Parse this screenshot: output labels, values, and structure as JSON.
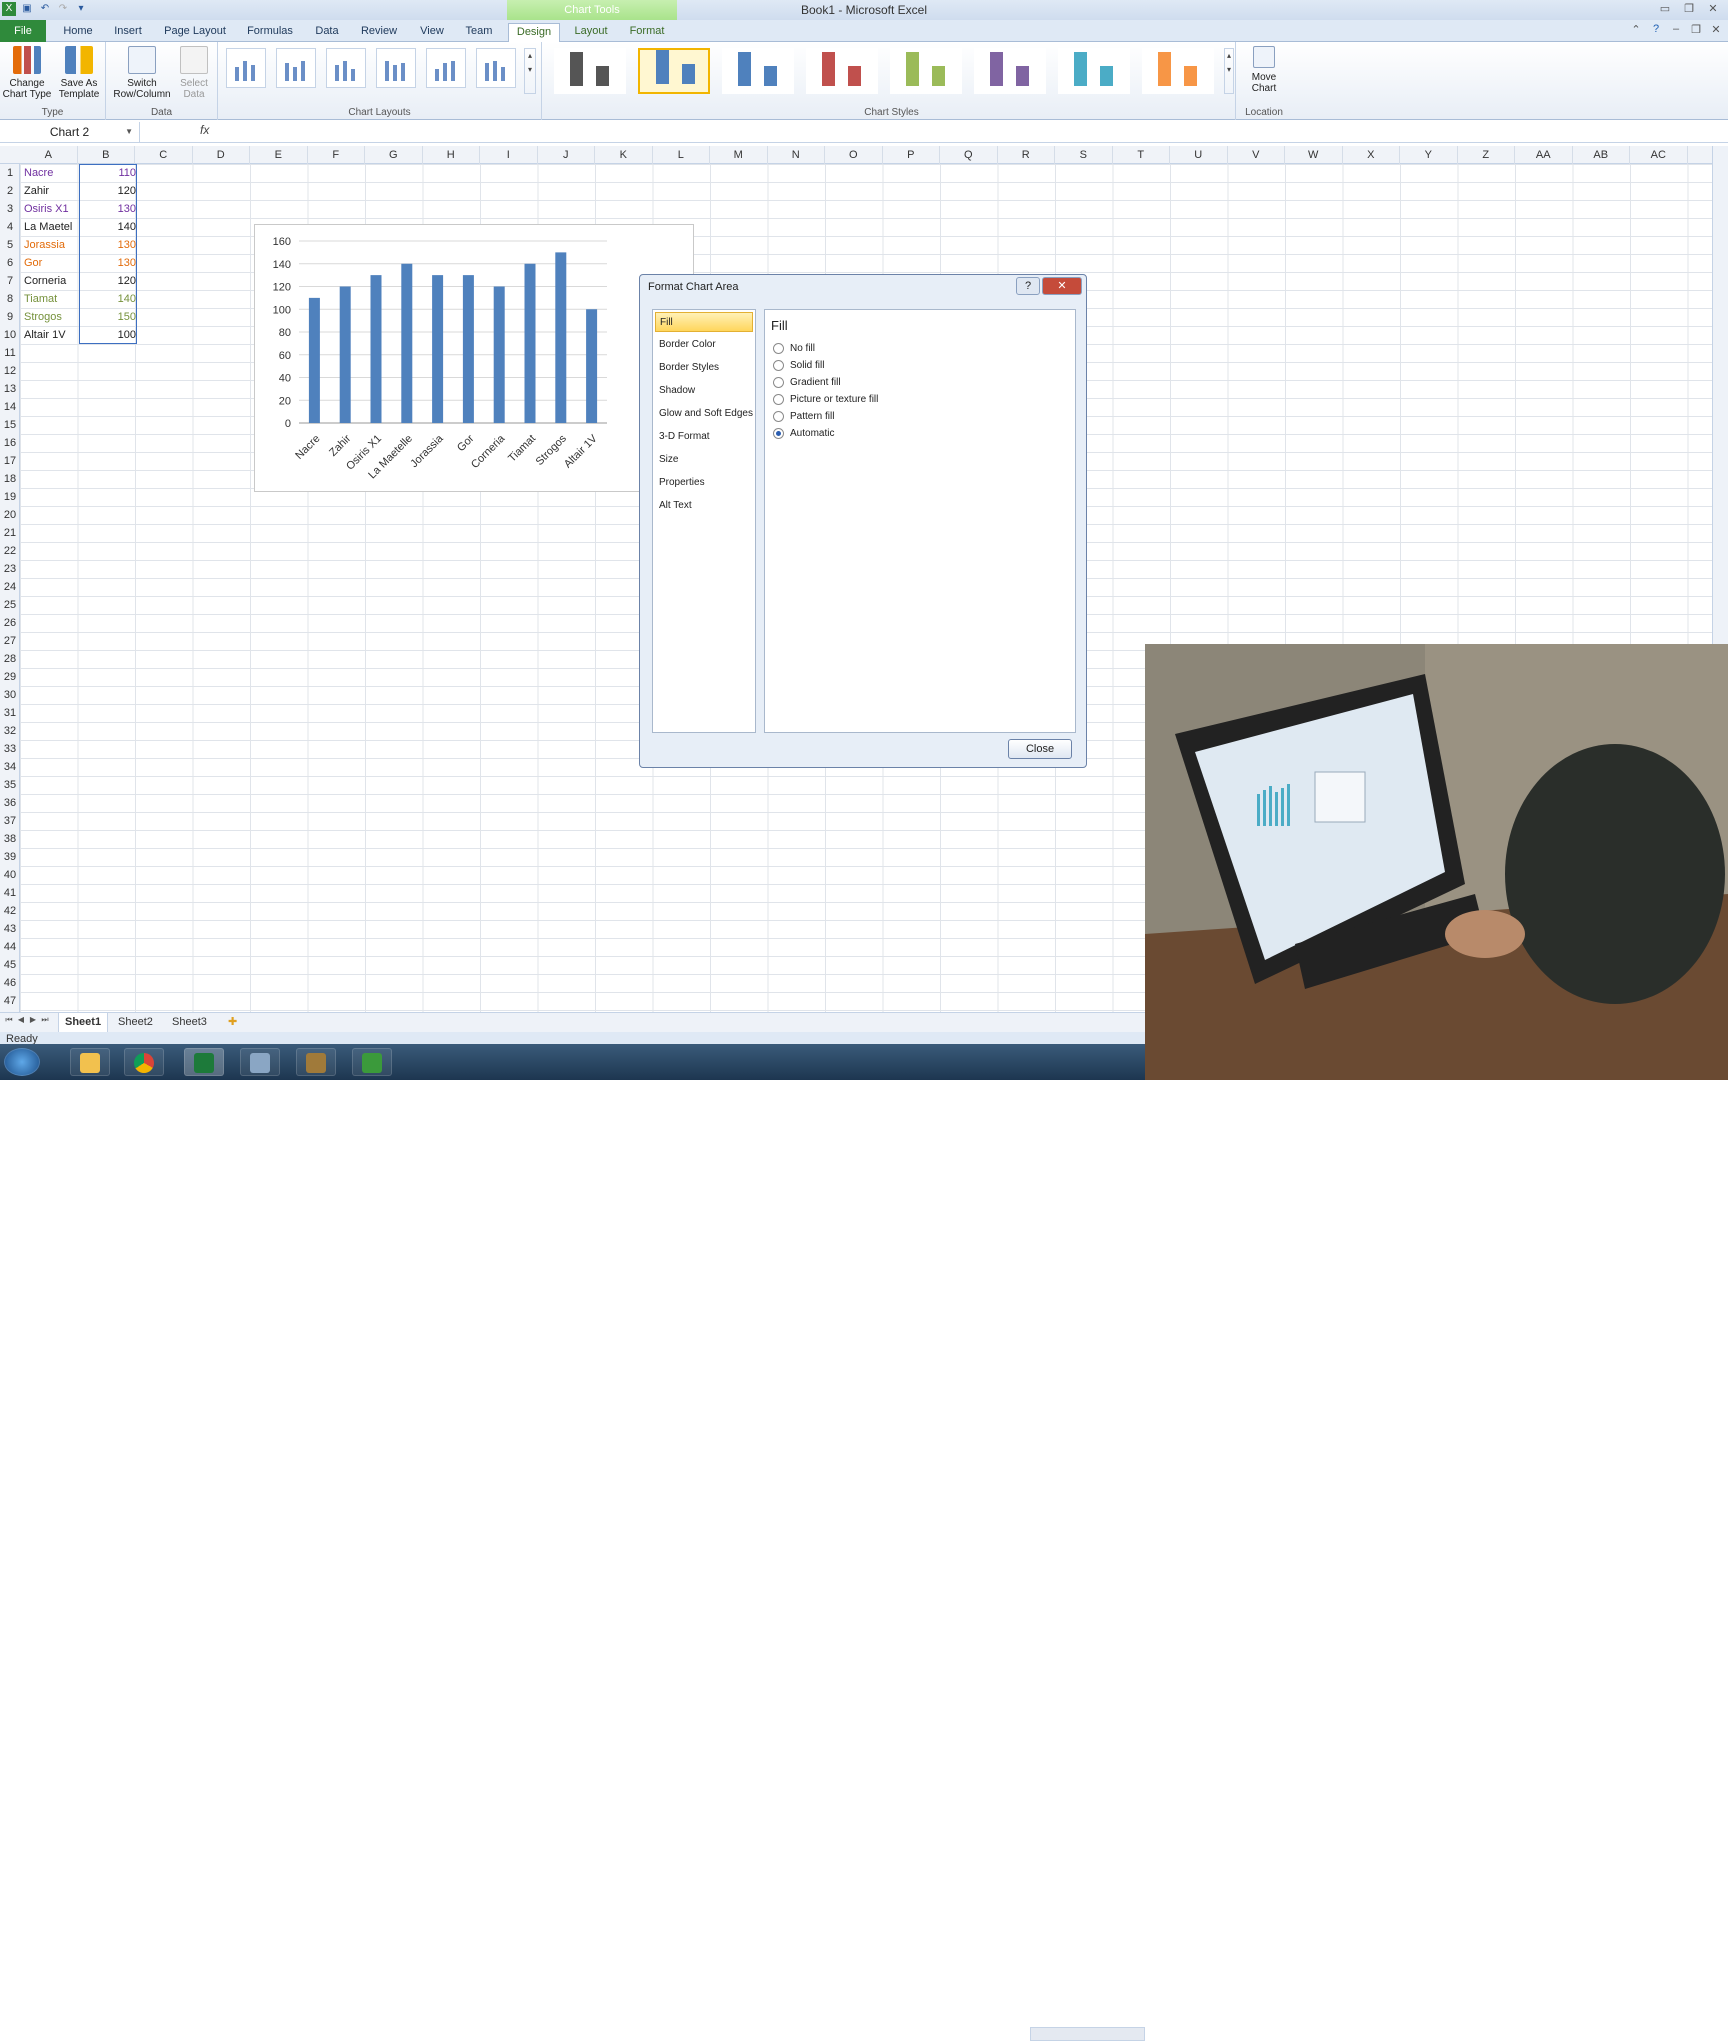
{
  "window": {
    "title": "Book1 - Microsoft Excel",
    "context_group": "Chart Tools"
  },
  "tabs": [
    {
      "label": "File"
    },
    {
      "label": "Home"
    },
    {
      "label": "Insert"
    },
    {
      "label": "Page Layout"
    },
    {
      "label": "Formulas"
    },
    {
      "label": "Data"
    },
    {
      "label": "Review"
    },
    {
      "label": "View"
    },
    {
      "label": "Team"
    },
    {
      "label": "Design"
    },
    {
      "label": "Layout"
    },
    {
      "label": "Format"
    }
  ],
  "ribbon": {
    "type_group": {
      "label": "Type",
      "change_chart_type": "Change Chart Type",
      "save_as_template": "Save As Template"
    },
    "data_group": {
      "label": "Data",
      "switch_row_column": "Switch Row/Column",
      "select_data": "Select Data"
    },
    "chart_layouts_label": "Chart Layouts",
    "chart_styles_label": "Chart Styles",
    "location_group": {
      "label": "Location",
      "move_chart": "Move Chart"
    },
    "style_colors": [
      "#555555",
      "#4f81bd",
      "#4f81bd",
      "#c0504d",
      "#9bbb59",
      "#8064a2",
      "#4bacc6",
      "#f79646"
    ]
  },
  "formula_bar": {
    "name_box": "Chart 2",
    "fx_label": "fx",
    "formula": ""
  },
  "columns": [
    "A",
    "B",
    "C",
    "D",
    "E",
    "F",
    "G",
    "H",
    "I",
    "J",
    "K",
    "L",
    "M",
    "N",
    "O",
    "P",
    "Q",
    "R",
    "S",
    "T",
    "U",
    "V",
    "W",
    "X",
    "Y",
    "Z",
    "AA",
    "AB",
    "AC"
  ],
  "rows": [
    "1",
    "2",
    "3",
    "4",
    "5",
    "6",
    "7",
    "8",
    "9",
    "10",
    "11",
    "12",
    "13",
    "14",
    "15",
    "16",
    "17",
    "18",
    "19",
    "20",
    "21",
    "22",
    "23",
    "24",
    "25",
    "26",
    "27",
    "28",
    "29",
    "30",
    "31",
    "32",
    "33",
    "34",
    "35",
    "36",
    "37",
    "38",
    "39",
    "40",
    "41",
    "42",
    "43",
    "44",
    "45",
    "46",
    "47"
  ],
  "sheet_data": [
    {
      "name": "Nacre",
      "value": "110",
      "color": "#7030a0"
    },
    {
      "name": "Zahir",
      "value": "120",
      "color": "#222222"
    },
    {
      "name": "Osiris X1",
      "value": "130",
      "color": "#7030a0"
    },
    {
      "name": "La Maetel",
      "value": "140",
      "color": "#222222"
    },
    {
      "name": "Jorassia",
      "value": "130",
      "color": "#e26b0a"
    },
    {
      "name": "Gor",
      "value": "130",
      "color": "#e26b0a"
    },
    {
      "name": "Corneria",
      "value": "120",
      "color": "#222222"
    },
    {
      "name": "Tiamat",
      "value": "140",
      "color": "#76923c"
    },
    {
      "name": "Strogos",
      "value": "150",
      "color": "#76923c"
    },
    {
      "name": "Altair 1V",
      "value": "100",
      "color": "#222222"
    }
  ],
  "chart_data": {
    "type": "bar",
    "categories": [
      "Nacre",
      "Zahir",
      "Osiris X1",
      "La Maetelle",
      "Jorassia",
      "Gor",
      "Corneria",
      "Tiamat",
      "Strogos",
      "Altair 1V"
    ],
    "values": [
      110,
      120,
      130,
      140,
      130,
      130,
      120,
      140,
      150,
      100
    ],
    "yticks": [
      "0",
      "20",
      "40",
      "60",
      "80",
      "100",
      "120",
      "140",
      "160"
    ],
    "ylim": [
      0,
      160
    ],
    "grid": true,
    "bar_color": "#4f81bd"
  },
  "dialog": {
    "title": "Format Chart Area",
    "help": "?",
    "close_x": "✕",
    "nav": [
      "Fill",
      "Border Color",
      "Border Styles",
      "Shadow",
      "Glow and Soft Edges",
      "3-D Format",
      "Size",
      "Properties",
      "Alt Text"
    ],
    "pane_title": "Fill",
    "options": [
      {
        "label": "No fill",
        "selected": false
      },
      {
        "label": "Solid fill",
        "selected": false
      },
      {
        "label": "Gradient fill",
        "selected": false
      },
      {
        "label": "Picture or texture fill",
        "selected": false
      },
      {
        "label": "Pattern fill",
        "selected": false
      },
      {
        "label": "Automatic",
        "selected": true
      }
    ],
    "close_button": "Close"
  },
  "sheets": [
    "Sheet1",
    "Sheet2",
    "Sheet3"
  ],
  "status": "Ready",
  "taskbar_icons": [
    "start-orb-icon",
    "explorer-icon",
    "chrome-icon",
    "excel-icon",
    "app-icon",
    "app2-icon",
    "camtasia-icon"
  ]
}
